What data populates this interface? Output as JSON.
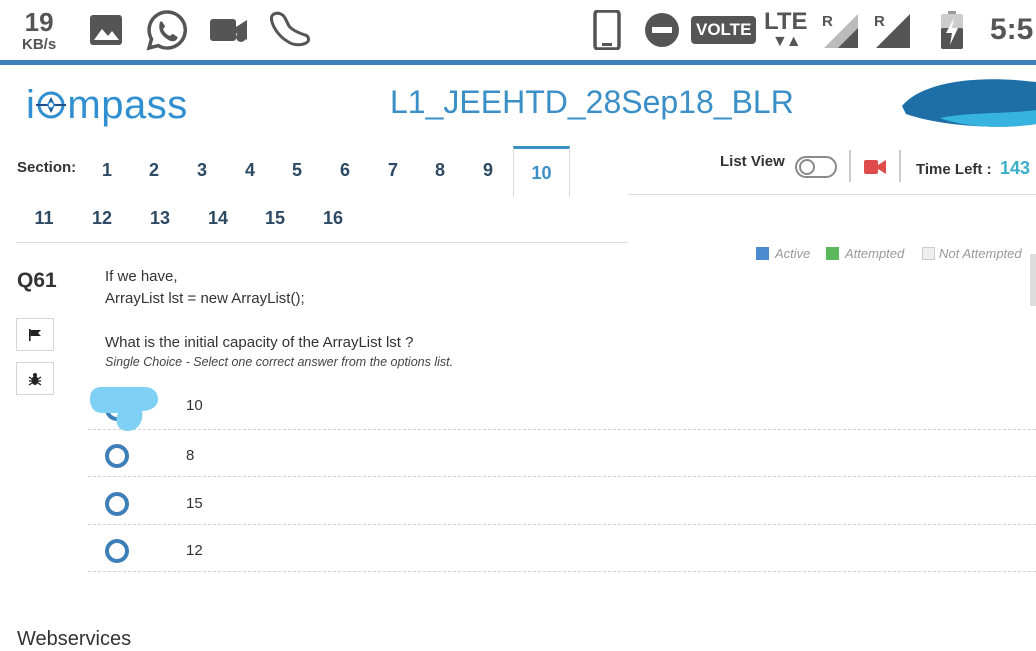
{
  "status_bar": {
    "speed_value": "19",
    "speed_unit": "KB/s",
    "volte": "VOLTE",
    "lte": "LTE",
    "roaming_1": "R",
    "roaming_2": "R",
    "time": "5:5",
    "icons": [
      "image-icon",
      "whatsapp-icon",
      "video-call-icon",
      "shoe-icon",
      "phone-icon",
      "do-not-disturb-icon",
      "signal-icon",
      "battery-charging-icon"
    ]
  },
  "header": {
    "logo_left": "i",
    "logo_right": "mpass",
    "title": "L1_JEEHTD_28Sep18_BLR"
  },
  "sections": {
    "label": "Section:",
    "tabs": [
      "1",
      "2",
      "3",
      "4",
      "5",
      "6",
      "7",
      "8",
      "9",
      "10",
      "11",
      "12",
      "13",
      "14",
      "15",
      "16"
    ],
    "active": "10"
  },
  "controls": {
    "list_view_label": "List View",
    "list_view_on": false,
    "time_left_label": "Time Left :",
    "time_left_value": "143"
  },
  "legend": {
    "active": "Active",
    "attempted": "Attempted",
    "not_attempted": "Not Attempted",
    "colors": {
      "active": "#4a8ccf",
      "attempted": "#5cb85c",
      "not_attempted": "#eeeeee"
    }
  },
  "question": {
    "number": "Q61",
    "line1": "If we have,",
    "line2": "ArrayList lst = new ArrayList();",
    "line3": "What is the initial capacity of the ArrayList lst ?",
    "hint": "Single Choice - Select one correct answer from the options list.",
    "options": [
      "10",
      "8",
      "15",
      "12"
    ]
  },
  "next_section": "Webservices",
  "colors": {
    "accent": "#3a8fc6",
    "radio": "#3d7fb8",
    "blot": "#7fd0f5"
  }
}
